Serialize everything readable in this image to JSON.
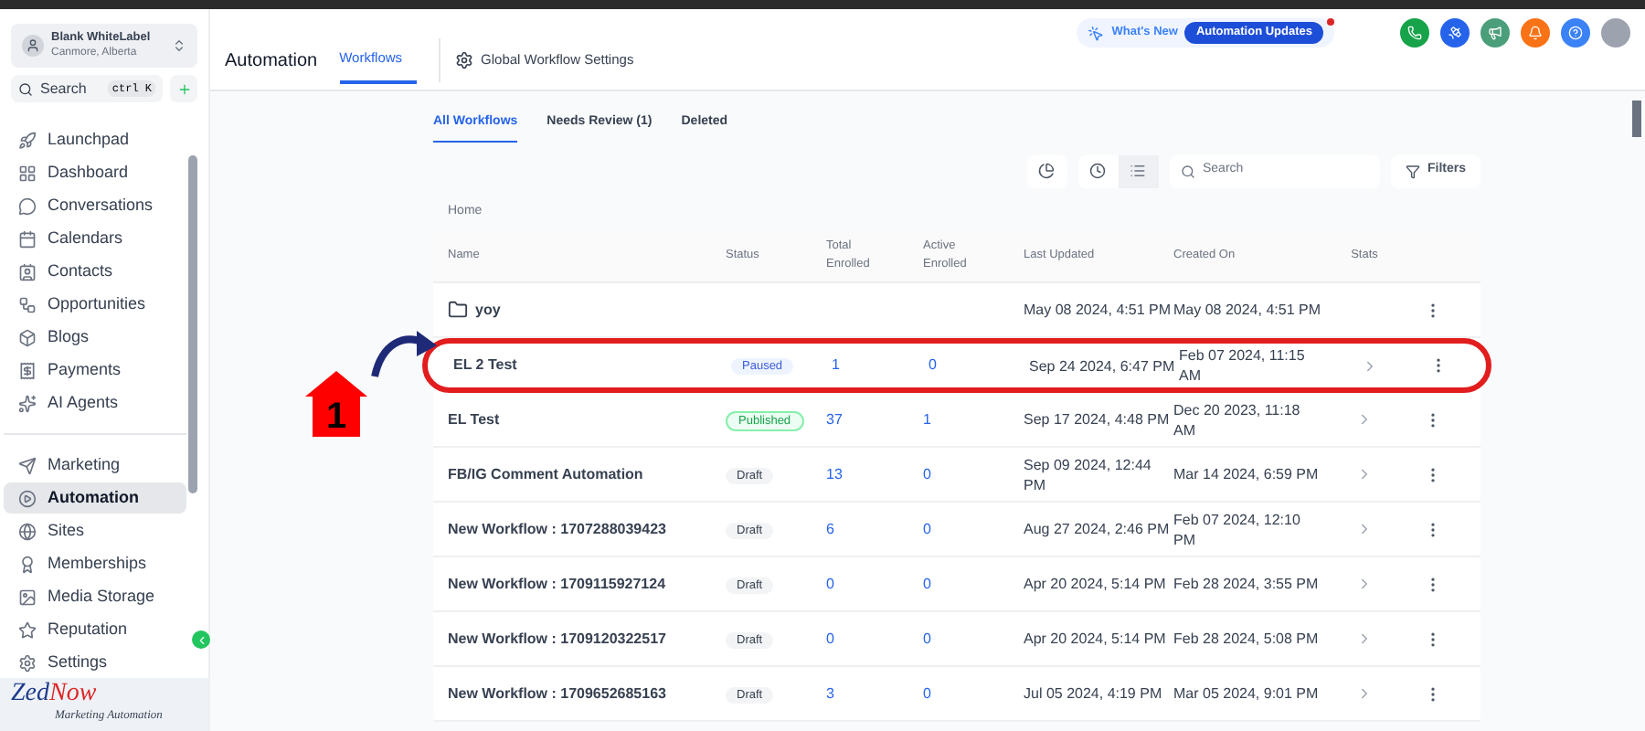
{
  "account": {
    "name": "Blank WhiteLabel",
    "location": "Canmore, Alberta"
  },
  "search": {
    "placeholder": "Search",
    "shortcut": "ctrl K"
  },
  "sidebar": {
    "groups": [
      [
        {
          "label": "Launchpad",
          "selected": false
        },
        {
          "label": "Dashboard",
          "selected": false
        },
        {
          "label": "Conversations",
          "selected": false
        },
        {
          "label": "Calendars",
          "selected": false
        },
        {
          "label": "Contacts",
          "selected": false
        },
        {
          "label": "Opportunities",
          "selected": false
        },
        {
          "label": "Blogs",
          "selected": false
        },
        {
          "label": "Payments",
          "selected": false
        },
        {
          "label": "AI Agents",
          "selected": false
        }
      ],
      [
        {
          "label": "Marketing",
          "selected": false
        },
        {
          "label": "Automation",
          "selected": true
        },
        {
          "label": "Sites",
          "selected": false
        },
        {
          "label": "Memberships",
          "selected": false
        },
        {
          "label": "Media Storage",
          "selected": false
        },
        {
          "label": "Reputation",
          "selected": false
        },
        {
          "label": "Settings",
          "selected": false
        }
      ]
    ]
  },
  "logo": {
    "brand_1": "Zed",
    "brand_2": "Now",
    "tagline": "Marketing Automation"
  },
  "header": {
    "title": "Automation",
    "tabs": [
      {
        "label": "Workflows",
        "selected": true
      },
      {
        "label": "Global Workflow Settings",
        "selected": false
      }
    ],
    "whats_new": "What's New",
    "updates_badge": "Automation Updates"
  },
  "subtabs": [
    {
      "label": "All Workflows",
      "selected": true
    },
    {
      "label": "Needs Review (1)",
      "selected": false
    },
    {
      "label": "Deleted",
      "selected": false
    }
  ],
  "toolbar": {
    "search_placeholder": "Search",
    "filters": "Filters"
  },
  "table": {
    "breadcrumb": "Home",
    "columns": [
      "Name",
      "Status",
      "Total Enrolled",
      "Active Enrolled",
      "Last Updated",
      "Created On",
      "Stats"
    ],
    "rows": [
      {
        "kind": "folder",
        "name": "yoy",
        "last_updated": "May 08 2024, 4:51 PM",
        "created_on": "May 08 2024, 4:51 PM",
        "highlighted": false
      },
      {
        "kind": "workflow",
        "name": "EL 2 Test",
        "status": {
          "text": "Paused",
          "kind": "paused"
        },
        "total": "1",
        "active": "0",
        "last_updated": "Sep 24 2024, 6:47 PM",
        "created_on": "Feb 07 2024, 11:15 AM",
        "highlighted": true
      },
      {
        "kind": "workflow",
        "name": "EL Test",
        "status": {
          "text": "Published",
          "kind": "published"
        },
        "total": "37",
        "active": "1",
        "last_updated": "Sep 17 2024, 4:48 PM",
        "created_on": "Dec 20 2023, 11:18 AM",
        "highlighted": false
      },
      {
        "kind": "workflow",
        "name": "FB/IG Comment Automation",
        "status": {
          "text": "Draft",
          "kind": "draft"
        },
        "total": "13",
        "active": "0",
        "last_updated": "Sep 09 2024, 12:44 PM",
        "created_on": "Mar 14 2024, 6:59 PM",
        "highlighted": false
      },
      {
        "kind": "workflow",
        "name": "New Workflow : 1707288039423",
        "status": {
          "text": "Draft",
          "kind": "draft"
        },
        "total": "6",
        "active": "0",
        "last_updated": "Aug 27 2024, 2:46 PM",
        "created_on": "Feb 07 2024, 12:10 PM",
        "highlighted": false
      },
      {
        "kind": "workflow",
        "name": "New Workflow : 1709115927124",
        "status": {
          "text": "Draft",
          "kind": "draft"
        },
        "total": "0",
        "active": "0",
        "last_updated": "Apr 20 2024, 5:14 PM",
        "created_on": "Feb 28 2024, 3:55 PM",
        "highlighted": false
      },
      {
        "kind": "workflow",
        "name": "New Workflow : 1709120322517",
        "status": {
          "text": "Draft",
          "kind": "draft"
        },
        "total": "0",
        "active": "0",
        "last_updated": "Apr 20 2024, 5:14 PM",
        "created_on": "Feb 28 2024, 5:08 PM",
        "highlighted": false
      },
      {
        "kind": "workflow",
        "name": "New Workflow : 1709652685163",
        "status": {
          "text": "Draft",
          "kind": "draft"
        },
        "total": "3",
        "active": "0",
        "last_updated": "Jul 05 2024, 4:19 PM",
        "created_on": "Mar 05 2024, 9:01 PM",
        "highlighted": false
      }
    ]
  },
  "annotation": {
    "label": "1"
  }
}
